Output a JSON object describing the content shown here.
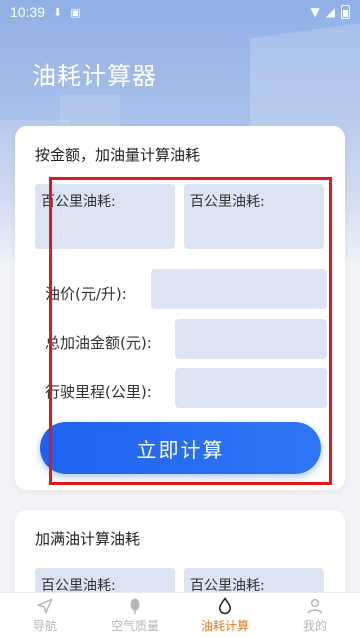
{
  "status_bar": {
    "time": "10:39"
  },
  "header": {
    "title": "油耗计算器"
  },
  "card1": {
    "title": "按金额，加油量计算油耗",
    "result_left_label": "百公里油耗:",
    "result_right_label": "百公里油耗:",
    "fields": [
      {
        "label": "油价(元/升):",
        "value": "",
        "placeholder": ""
      },
      {
        "label": "总加油金额(元):",
        "value": "",
        "placeholder": ""
      },
      {
        "label": "行驶里程(公里):",
        "value": "",
        "placeholder": ""
      }
    ],
    "button_label": "立即计算"
  },
  "card2": {
    "title": "加满油计算油耗",
    "result_left_label": "百公里油耗:",
    "result_right_label": "百公里油耗:"
  },
  "tabs": [
    {
      "label": "导航",
      "icon": "navigation-arrow-icon"
    },
    {
      "label": "空气质量",
      "icon": "leaf-icon"
    },
    {
      "label": "油耗计算",
      "icon": "fuel-drop-icon",
      "active": true
    },
    {
      "label": "我的",
      "icon": "user-icon"
    }
  ],
  "colors": {
    "accent": "#1e62f0",
    "active_tab": "#e07b1f",
    "highlight": "#e01818",
    "field_bg": "#dce3f2"
  }
}
